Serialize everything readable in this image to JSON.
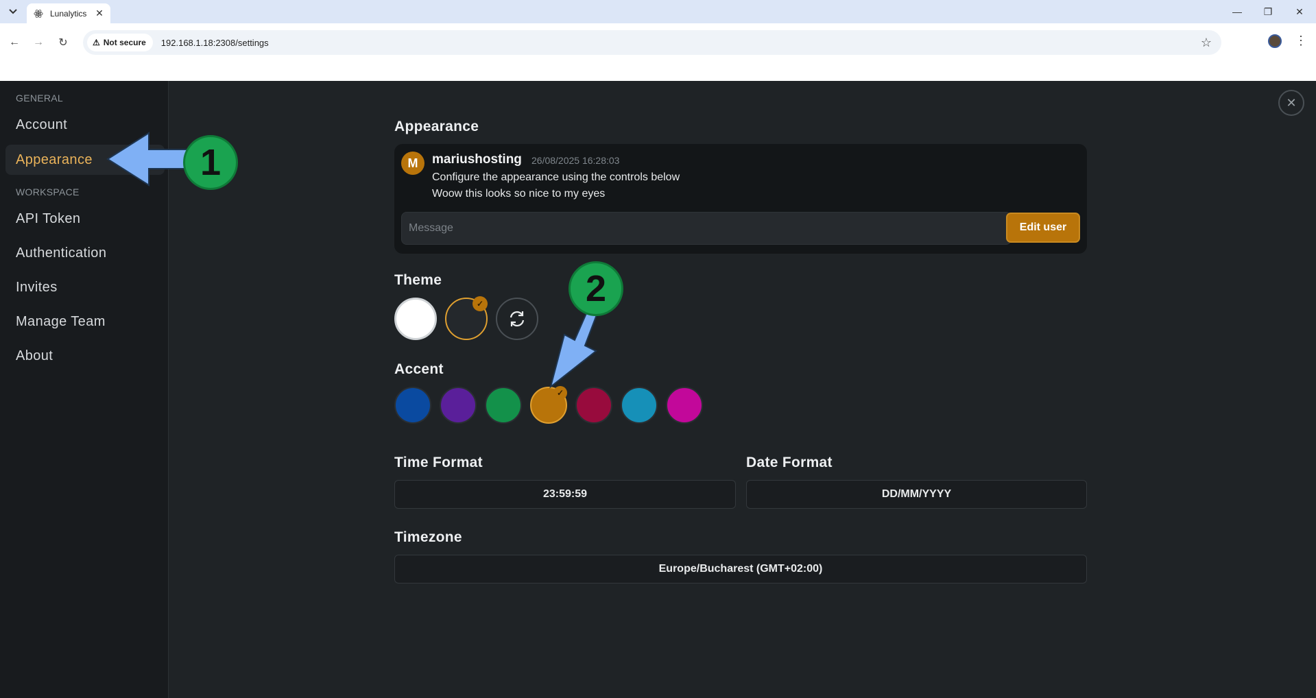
{
  "browser": {
    "tab_title": "Lunalytics",
    "security_label": "Not secure",
    "url": "192.168.1.18:2308/settings"
  },
  "sidebar": {
    "sections": [
      {
        "label": "GENERAL"
      },
      {
        "label": "WORKSPACE"
      }
    ],
    "items": [
      {
        "label": "Account"
      },
      {
        "label": "Appearance"
      },
      {
        "label": "API Token"
      },
      {
        "label": "Authentication"
      },
      {
        "label": "Invites"
      },
      {
        "label": "Manage Team"
      },
      {
        "label": "About"
      }
    ],
    "active_item": "Appearance"
  },
  "main": {
    "title": "Appearance",
    "preview": {
      "avatar_letter": "M",
      "username": "mariushosting",
      "timestamp": "26/08/2025 16:28:03",
      "lines": [
        "Configure the appearance using the controls below",
        "Woow this looks so nice to my eyes"
      ],
      "input_placeholder": "Message",
      "edit_button": "Edit user"
    },
    "theme": {
      "label": "Theme",
      "options": [
        "light",
        "dark",
        "system"
      ],
      "selected": "dark"
    },
    "accent": {
      "label": "Accent",
      "colors": [
        "#0a4aa0",
        "#5a1f9a",
        "#13914a",
        "#b8740a",
        "#980b3d",
        "#1690b8",
        "#c2089a"
      ],
      "selected": "#b8740a"
    },
    "time_format": {
      "label": "Time Format",
      "value": "23:59:59"
    },
    "date_format": {
      "label": "Date Format",
      "value": "DD/MM/YYYY"
    },
    "timezone": {
      "label": "Timezone",
      "value": "Europe/Bucharest (GMT+02:00)"
    }
  },
  "annotations": [
    {
      "number": "1"
    },
    {
      "number": "2"
    }
  ],
  "colors": {
    "accent": "#b8740a",
    "callout_green": "#1aa350",
    "callout_arrow": "#7fb0f5"
  }
}
